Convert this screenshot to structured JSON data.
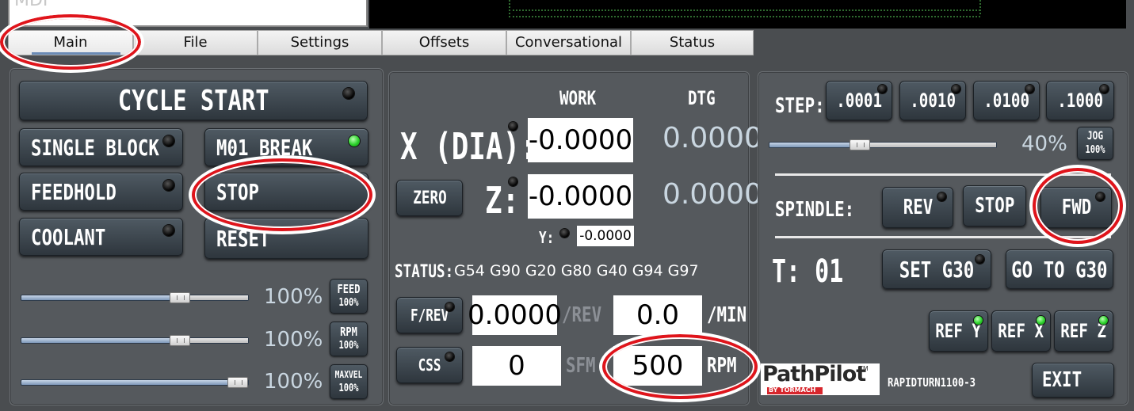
{
  "mdi": {
    "text": "MDI"
  },
  "tabs": [
    {
      "label": "Main"
    },
    {
      "label": "File"
    },
    {
      "label": "Settings"
    },
    {
      "label": "Offsets"
    },
    {
      "label": "Conversational"
    },
    {
      "label": "Status"
    }
  ],
  "left": {
    "cycle_start": "CYCLE START",
    "single_block": "SINGLE BLOCK",
    "m01_break": "M01 BREAK",
    "feedhold": "FEEDHOLD",
    "stop": "STOP",
    "coolant": "COOLANT",
    "reset": "RESET",
    "sliders": [
      {
        "percent": "100%",
        "badge_top": "FEED",
        "badge_bottom": "100%",
        "value": 0.7
      },
      {
        "percent": "100%",
        "badge_top": "RPM",
        "badge_bottom": "100%",
        "value": 0.7
      },
      {
        "percent": "100%",
        "badge_top": "MAXVEL",
        "badge_bottom": "100%",
        "value": 1.0
      }
    ]
  },
  "dro": {
    "work_header": "WORK",
    "dtg_header": "DTG",
    "x_label": "X (DIA):",
    "x_work": "-0.0000",
    "x_dtg": "0.0000",
    "zero_button": "ZERO",
    "z_label": "Z:",
    "z_work": "-0.0000",
    "z_dtg": "0.0000",
    "y_label": "Y:",
    "y_work": "-0.0000",
    "status_label": "STATUS:",
    "status_codes": "G54 G90 G20 G80 G40 G94 G97",
    "frev_button": "F/REV",
    "feed_rev": "0.0000",
    "feed_rev_unit": "/REV",
    "feed_min": "0.0",
    "feed_min_unit": "/MIN",
    "css_button": "CSS",
    "sfm_value": "0",
    "sfm_unit": "SFM",
    "rpm_value": "500",
    "rpm_unit": "RPM"
  },
  "right": {
    "step_label": "STEP:",
    "steps": [
      ".0001",
      ".0010",
      ".0100",
      ".1000"
    ],
    "jog_percent": "40%",
    "jog_badge_top": "JOG",
    "jog_badge_bottom": "100%",
    "jog_value": 0.4,
    "spindle_label": "SPINDLE:",
    "rev_button": "REV",
    "stop_button": "STOP",
    "fwd_button": "FWD",
    "tool_label": "T: 01",
    "set_g30": "SET G30",
    "go_to_g30": "GO TO G30",
    "ref_y": "REF Y",
    "ref_x": "REF X",
    "ref_z": "REF Z",
    "logo_main": "PathPilot",
    "logo_tm": "TM",
    "logo_sub": "BY TORMACH",
    "machine_model": "RAPIDTURN1100-3",
    "exit_button": "EXIT"
  },
  "colors": {
    "panel": "#55595d",
    "button": "#3a444c",
    "led_green": "#2bd12b",
    "annotation_ring": "#e0141b",
    "dtg_text": "#c9d6e0"
  }
}
